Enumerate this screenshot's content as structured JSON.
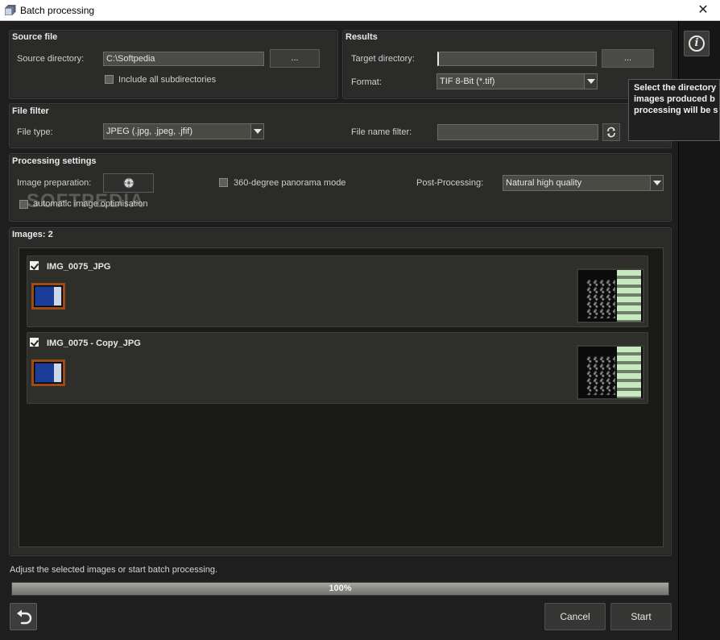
{
  "window": {
    "title": "Batch processing",
    "close_glyph": "✕"
  },
  "source_file": {
    "title": "Source file",
    "directory_label": "Source directory:",
    "directory_value": "C:\\Softpedia",
    "browse_label": "...",
    "subdirs_label": "Include all subdirectories",
    "subdirs_checked": false
  },
  "results": {
    "title": "Results",
    "target_label": "Target directory:",
    "target_value": "",
    "browse_label": "...",
    "format_label": "Format:",
    "format_value": "TIF 8-Bit (*.tif)"
  },
  "tooltip": {
    "text": "Select the directory\nimages produced b\nprocessing will be s"
  },
  "file_filter": {
    "title": "File filter",
    "type_label": "File type:",
    "type_value": "JPEG (.jpg, .jpeg, .jfif)",
    "name_filter_label": "File name filter:",
    "name_filter_value": ""
  },
  "processing": {
    "title": "Processing settings",
    "image_prep_label": "Image preparation:",
    "panorama_label": "360-degree panorama mode",
    "panorama_checked": false,
    "post_label": "Post-Processing:",
    "post_value": "Natural high quality",
    "auto_opt_label": "automatic image optimisation",
    "auto_opt_checked": false
  },
  "watermark": "SOFTPEDIA",
  "images": {
    "title": "Images: 2",
    "items": [
      {
        "name": "IMG_0075_JPG",
        "checked": true
      },
      {
        "name": "IMG_0075 - Copy_JPG",
        "checked": true
      }
    ]
  },
  "status": {
    "message": "Adjust the selected images or start batch processing.",
    "progress_percent": 100,
    "progress_label": "100%"
  },
  "buttons": {
    "cancel": "Cancel",
    "start": "Start"
  },
  "icons": [
    "batch-app-icon",
    "close-icon",
    "info-icon",
    "refresh-icon",
    "image-prep-icon",
    "undo-icon",
    "dropdown-arrow-icon",
    "checkbox-icon"
  ],
  "colors": {
    "background": "#1e1e1e",
    "panel": "#2b2b29",
    "field": "#4b4b47",
    "progress_fill": "#8a8a84"
  }
}
